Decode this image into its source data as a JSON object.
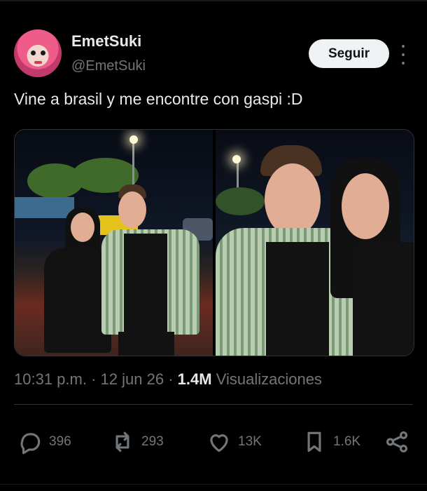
{
  "post": {
    "display_name": "EmetSuki",
    "handle": "@EmetSuki",
    "follow_label": "Seguir",
    "text": "Vine a brasil y me encontre con gaspi :D",
    "time": "10:31 p.m.",
    "separator": "·",
    "date": "12 jun 26",
    "views_count": "1.4M",
    "views_label": "Visualizaciones"
  },
  "actions": {
    "replies": "396",
    "reposts": "293",
    "likes": "13K",
    "bookmarks": "1.6K"
  },
  "icons": {
    "reply": "reply-icon",
    "repost": "repost-icon",
    "like": "heart-icon",
    "bookmark": "bookmark-icon",
    "share": "share-icon",
    "more": "more-icon"
  },
  "colors": {
    "background": "#000000",
    "text": "#e7e9ea",
    "muted": "#71767b",
    "follow_button_bg": "#eff3f4",
    "divider": "#2f3336"
  }
}
